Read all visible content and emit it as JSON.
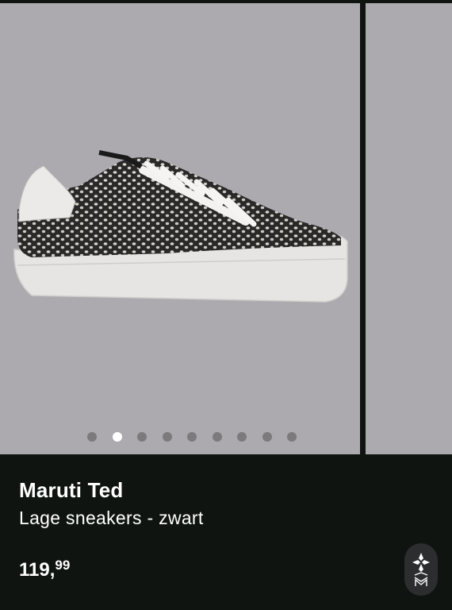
{
  "product": {
    "brand": "Maruti Ted",
    "description": "Lage sneakers - zwart",
    "price_integer": "119,",
    "price_decimal": "99"
  },
  "carousel": {
    "slide_count": 9,
    "active_index": 1
  },
  "logo": {
    "icon": "brand-logo-icon"
  },
  "colors": {
    "background": "#0f1411",
    "image_bg": "#acaaaf",
    "dot_inactive": "#7c7a7d",
    "dot_active": "#ffffff",
    "text": "#ffffff"
  }
}
